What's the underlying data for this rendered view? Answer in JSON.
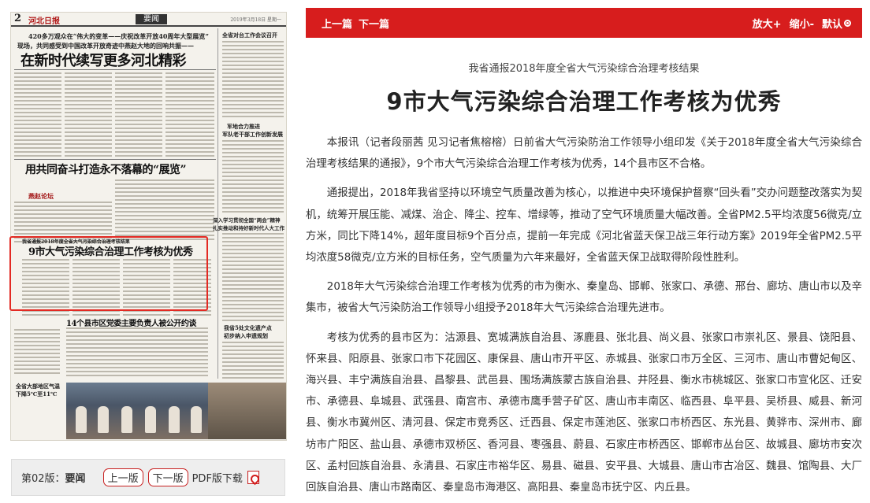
{
  "newspaper": {
    "page_num": "2",
    "masthead": "河北日报",
    "section": "要闻",
    "date": "2019年3月18日 星期一",
    "top_kicker": "420多万观众在“伟大的变革——庆祝改革开放40周年大型展览”",
    "top_kicker2": "现场，共同感受到中国改革开放奇迹中燕赵大地的回响共振——",
    "top_headline": "在新时代续写更多河北精彩",
    "mid_headline": "用共同奋斗打造永不落幕的“展览”",
    "column_sign": "燕赵论坛",
    "selected_kicker": "我省通报2018年度全省大气污染综合治理考核结果",
    "selected_headline": "9市大气污染综合治理工作考核为优秀",
    "bottom_headline": "14个县市区党委主要负责人被公开约谈",
    "side_items": [
      "全省对台工作会议召开",
      "军地合力推进",
      "军队老干部工作创新发展",
      "深入学习贯彻全国“两会”精神",
      "扎实推动和持好新时代人大工作",
      "我省5处文化遗产点",
      "初步纳入申遗规划",
      "全省大部地区气温",
      "下降5℃至11℃"
    ]
  },
  "pager": {
    "edition_prefix": "第02版：",
    "edition_name": "要闻",
    "prev_label": "上一版",
    "next_label": "下一版",
    "pdf_label": "PDF版下载"
  },
  "toolbar": {
    "prev_article": "上一篇",
    "next_article": "下一篇",
    "zoom_in": "放大+",
    "zoom_out": "缩小-",
    "default": "默认"
  },
  "article": {
    "subtitle": "我省通报2018年度全省大气污染综合治理考核结果",
    "title": "9市大气污染综合治理工作考核为优秀",
    "paragraphs": [
      "本报讯（记者段丽茜 见习记者焦榕榕）日前省大气污染防治工作领导小组印发《关于2018年度全省大气污染综合治理考核结果的通报》，9个市大气污染综合治理工作考核为优秀，14个县市区不合格。",
      "通报提出，2018年我省坚持以环境空气质量改善为核心，以推进中央环境保护督察“回头看”交办问题整改落实为契机，统筹开展压能、减煤、治企、降尘、控车、增绿等，推动了空气环境质量大幅改善。全省PM2.5平均浓度56微克/立方米，同比下降14%，超年度目标9个百分点，提前一年完成《河北省蓝天保卫战三年行动方案》2019年全省PM2.5平均浓度58微克/立方米的目标任务，空气质量为六年来最好，全省蓝天保卫战取得阶段性胜利。",
      "2018年大气污染综合治理工作考核为优秀的市为衡水、秦皇岛、邯郸、张家口、承德、邢台、廊坊、唐山市以及辛集市，被省大气污染防治工作领导小组授予2018年大气污染综合治理先进市。",
      "考核为优秀的县市区为：沽源县、宽城满族自治县、涿鹿县、张北县、尚义县、张家口市崇礼区、景县、饶阳县、怀来县、阳原县、张家口市下花园区、康保县、唐山市开平区、赤城县、张家口市万全区、三河市、唐山市曹妃甸区、海兴县、丰宁满族自治县、昌黎县、武邑县、围场满族蒙古族自治县、井陉县、衡水市桃城区、张家口市宣化区、迁安市、承德县、阜城县、武强县、南宫市、承德市鹰手营子矿区、唐山市丰南区、临西县、阜平县、吴桥县、威县、新河县、衡水市冀州区、清河县、保定市竞秀区、迁西县、保定市莲池区、张家口市桥西区、东光县、黄骅市、深州市、廊坊市广阳区、盐山县、承德市双桥区、香河县、枣强县、蔚县、石家庄市桥西区、邯郸市丛台区、故城县、廊坊市安次区、孟村回族自治县、永清县、石家庄市裕华区、易县、磁县、安平县、大城县、唐山市古冶区、魏县、馆陶县、大厂回族自治县、唐山市路南区、秦皇岛市海港区、高阳县、秦皇岛市抚宁区、内丘县。"
    ]
  }
}
